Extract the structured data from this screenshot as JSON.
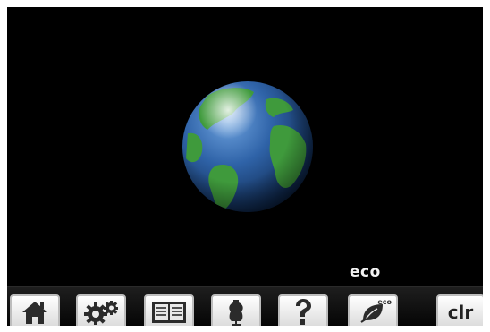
{
  "screen": {
    "mode_label": "eco",
    "globe_icon": "earth-globe-icon"
  },
  "toolbar": {
    "buttons": [
      {
        "name": "home-button",
        "icon": "home-icon"
      },
      {
        "name": "setup-button",
        "icon": "gears-icon"
      },
      {
        "name": "tutorial-button",
        "icon": "book-icon"
      },
      {
        "name": "creative-consultant-button",
        "icon": "dress-form-icon"
      },
      {
        "name": "help-button",
        "icon": "question-mark-icon"
      },
      {
        "name": "eco-button",
        "icon": "leaf-icon",
        "label": "eco"
      },
      {
        "name": "clear-button",
        "label": "clr"
      }
    ]
  },
  "colors": {
    "background": "#000000",
    "globe_ocean": "#2f63a8",
    "globe_land": "#3f9a3c",
    "button_face": "#f0f0f0"
  }
}
